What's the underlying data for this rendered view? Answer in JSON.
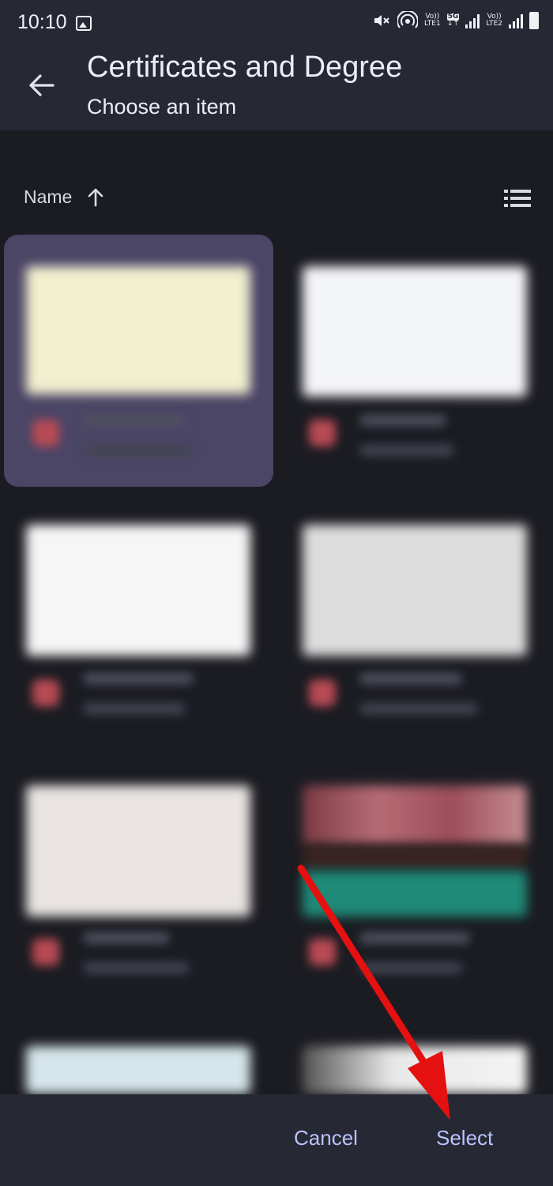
{
  "status_bar": {
    "time": "10:10",
    "network_left_label": "Vo))",
    "network_left_sub": "LTE1",
    "network_5g": "5G",
    "network_right_label": "Vo))",
    "network_right_sub": "LTE2"
  },
  "app_bar": {
    "title": "Certificates and Degree",
    "subtitle": "Choose an item",
    "back_icon": "arrow-left-icon"
  },
  "sort": {
    "label": "Name",
    "direction_icon": "arrow-up-icon",
    "view_icon": "list-view-icon"
  },
  "grid": {
    "items": [
      {
        "selected": true,
        "thumb_color": "#f2efcf"
      },
      {
        "selected": false,
        "thumb_color": "#f4f5f8"
      },
      {
        "selected": false,
        "thumb_color": "#f6f6f6"
      },
      {
        "selected": false,
        "thumb_color": "#dcdcdc"
      },
      {
        "selected": false,
        "thumb_color": "#e9e4e1"
      },
      {
        "selected": false,
        "thumb_color": "#9a5a5a"
      },
      {
        "selected": false,
        "thumb_color": "#d5e6ea"
      },
      {
        "selected": false,
        "thumb_color": "#e8e8e8"
      }
    ]
  },
  "actions": {
    "cancel_label": "Cancel",
    "select_label": "Select"
  },
  "colors": {
    "accent": "#bcc2ff",
    "selected_tile": "#4b4566",
    "annotation_arrow": "#e51010"
  }
}
